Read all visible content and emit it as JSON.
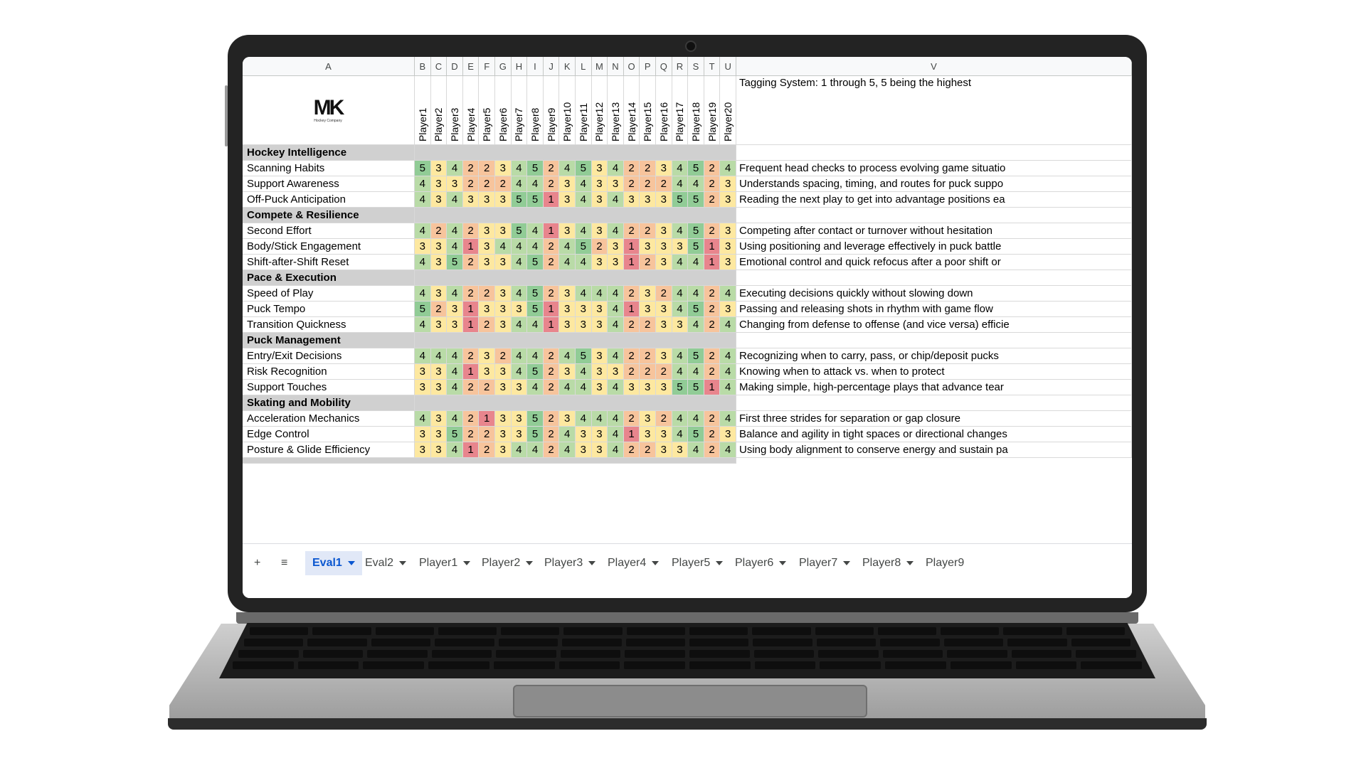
{
  "sheet": {
    "column_letters": [
      "A",
      "B",
      "C",
      "D",
      "E",
      "F",
      "G",
      "H",
      "I",
      "J",
      "K",
      "L",
      "M",
      "N",
      "O",
      "P",
      "Q",
      "R",
      "S",
      "T",
      "U",
      "V"
    ],
    "logo_text": "MK",
    "logo_subtext": "Hockey Company",
    "legend_note": "Tagging System: 1 through 5, 5 being the highest",
    "players": [
      "Player1",
      "Player2",
      "Player3",
      "Player4",
      "Player5",
      "Player6",
      "Player7",
      "Player8",
      "Player9",
      "Player10",
      "Player11",
      "Player12",
      "Player13",
      "Player14",
      "Player15",
      "Player16",
      "Player17",
      "Player18",
      "Player19",
      "Player20"
    ],
    "score_colors": {
      "1": "#e8858d",
      "2": "#f7c49c",
      "3": "#fde8a0",
      "4": "#b9dba7",
      "5": "#91cc96"
    },
    "rows": [
      {
        "type": "category",
        "label": "Hockey Intelligence"
      },
      {
        "type": "skill",
        "label": "Scanning Habits",
        "scores": [
          5,
          3,
          4,
          2,
          2,
          3,
          4,
          5,
          2,
          4,
          5,
          3,
          4,
          2,
          2,
          3,
          4,
          5,
          2,
          4
        ],
        "desc": "Frequent head checks to process evolving game situatio"
      },
      {
        "type": "skill",
        "label": "Support Awareness",
        "scores": [
          4,
          3,
          3,
          2,
          2,
          2,
          4,
          4,
          2,
          3,
          4,
          3,
          3,
          2,
          2,
          2,
          4,
          4,
          2,
          3
        ],
        "desc": "Understands spacing, timing, and routes for puck suppo"
      },
      {
        "type": "skill",
        "label": "Off-Puck Anticipation",
        "scores": [
          4,
          3,
          4,
          3,
          3,
          3,
          5,
          5,
          1,
          3,
          4,
          3,
          4,
          3,
          3,
          3,
          5,
          5,
          2,
          3
        ],
        "desc": "Reading the next play to get into advantage positions ea"
      },
      {
        "type": "category",
        "label": "Compete & Resilience"
      },
      {
        "type": "skill",
        "label": "Second Effort",
        "scores": [
          4,
          2,
          4,
          2,
          3,
          3,
          5,
          4,
          1,
          3,
          4,
          3,
          4,
          2,
          2,
          3,
          4,
          5,
          2,
          3
        ],
        "desc": "Competing after contact or turnover without hesitation"
      },
      {
        "type": "skill",
        "label": "Body/Stick Engagement",
        "scores": [
          3,
          3,
          4,
          1,
          3,
          4,
          4,
          4,
          2,
          4,
          5,
          2,
          3,
          1,
          3,
          3,
          3,
          5,
          1,
          3
        ],
        "desc": "Using positioning and leverage effectively in puck battle"
      },
      {
        "type": "skill",
        "label": "Shift-after-Shift Reset",
        "scores": [
          4,
          3,
          5,
          2,
          3,
          3,
          4,
          5,
          2,
          4,
          4,
          3,
          3,
          1,
          2,
          3,
          4,
          4,
          1,
          3
        ],
        "desc": "Emotional control and quick refocus after a poor shift or"
      },
      {
        "type": "category",
        "label": "Pace & Execution"
      },
      {
        "type": "skill",
        "label": "Speed of Play",
        "scores": [
          4,
          3,
          4,
          2,
          2,
          3,
          4,
          5,
          2,
          3,
          4,
          4,
          4,
          2,
          3,
          2,
          4,
          4,
          2,
          4
        ],
        "desc": "Executing decisions quickly without slowing down"
      },
      {
        "type": "skill",
        "label": "Puck Tempo",
        "scores": [
          5,
          2,
          3,
          1,
          3,
          3,
          3,
          5,
          1,
          3,
          3,
          3,
          4,
          1,
          3,
          3,
          4,
          5,
          2,
          3
        ],
        "desc": "Passing and releasing shots in rhythm with game flow"
      },
      {
        "type": "skill",
        "label": "Transition Quickness",
        "scores": [
          4,
          3,
          3,
          1,
          2,
          3,
          4,
          4,
          1,
          3,
          3,
          3,
          4,
          2,
          2,
          3,
          3,
          4,
          2,
          4
        ],
        "desc": "Changing from defense to offense (and vice versa) efficie"
      },
      {
        "type": "category",
        "label": "Puck Management"
      },
      {
        "type": "skill",
        "label": "Entry/Exit Decisions",
        "scores": [
          4,
          4,
          4,
          2,
          3,
          2,
          4,
          4,
          2,
          4,
          5,
          3,
          4,
          2,
          2,
          3,
          4,
          5,
          2,
          4
        ],
        "desc": "Recognizing when to carry, pass, or chip/deposit pucks"
      },
      {
        "type": "skill",
        "label": "Risk Recognition",
        "scores": [
          3,
          3,
          4,
          1,
          3,
          3,
          4,
          5,
          2,
          3,
          4,
          3,
          3,
          2,
          2,
          2,
          4,
          4,
          2,
          4
        ],
        "desc": "Knowing when to attack vs. when to protect"
      },
      {
        "type": "skill",
        "label": "Support Touches",
        "scores": [
          3,
          3,
          4,
          2,
          2,
          3,
          3,
          4,
          2,
          4,
          4,
          3,
          4,
          3,
          3,
          3,
          5,
          5,
          1,
          4
        ],
        "desc": "Making simple, high-percentage plays that advance tear"
      },
      {
        "type": "category",
        "label": "Skating and Mobility"
      },
      {
        "type": "skill",
        "label": "Acceleration Mechanics",
        "scores": [
          4,
          3,
          4,
          2,
          1,
          3,
          3,
          5,
          2,
          3,
          4,
          4,
          4,
          2,
          3,
          2,
          4,
          4,
          2,
          4
        ],
        "desc": "First three strides for separation or gap closure"
      },
      {
        "type": "skill",
        "label": "Edge Control",
        "scores": [
          3,
          3,
          5,
          2,
          2,
          3,
          3,
          5,
          2,
          4,
          3,
          3,
          4,
          1,
          3,
          3,
          4,
          5,
          2,
          3
        ],
        "desc": "Balance and agility in tight spaces or directional changes"
      },
      {
        "type": "skill",
        "label": "Posture & Glide Efficiency",
        "scores": [
          3,
          3,
          4,
          1,
          2,
          3,
          4,
          4,
          2,
          4,
          3,
          3,
          4,
          2,
          2,
          3,
          3,
          4,
          2,
          4
        ],
        "desc": "Using body alignment to conserve energy and sustain pa"
      }
    ]
  },
  "tabbar": {
    "add_label": "+",
    "menu_label": "≡",
    "tabs": [
      "Eval1",
      "Eval2",
      "Player1",
      "Player2",
      "Player3",
      "Player4",
      "Player5",
      "Player6",
      "Player7",
      "Player8",
      "Player9"
    ],
    "active_index": 0
  }
}
